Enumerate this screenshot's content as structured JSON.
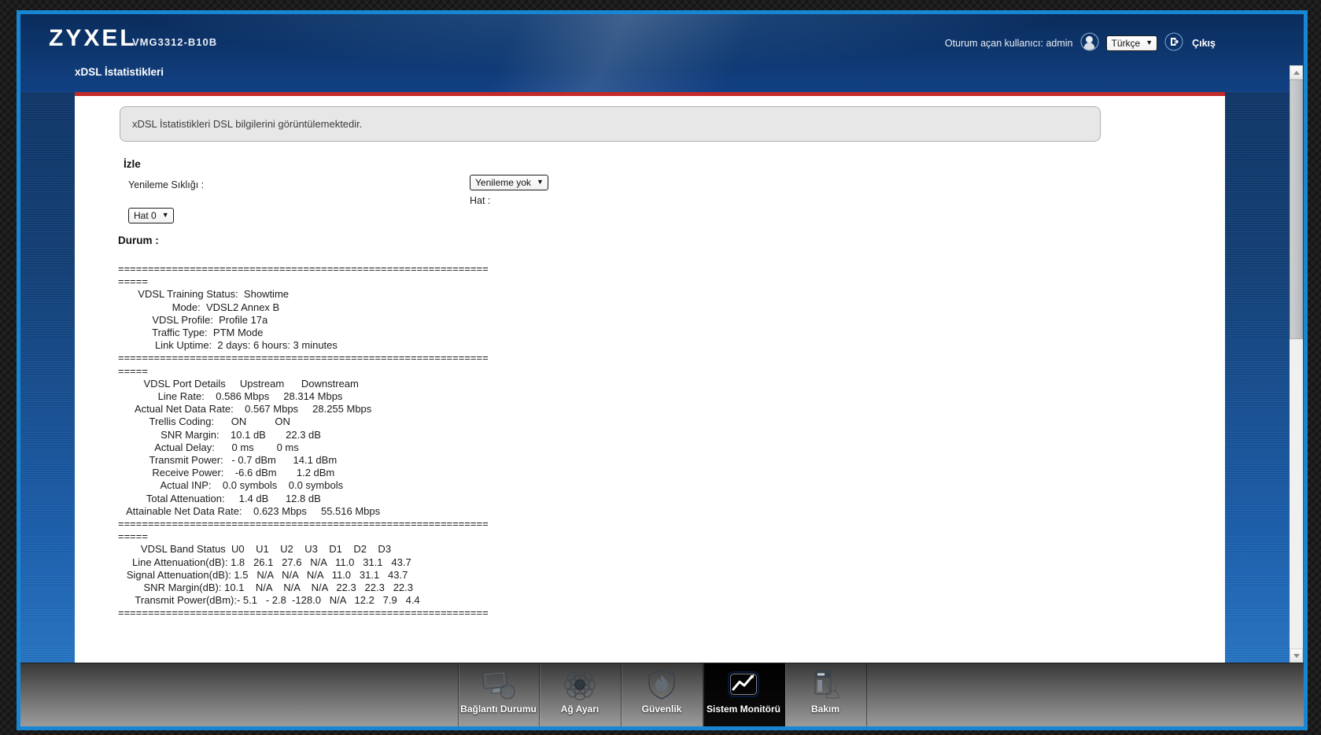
{
  "header": {
    "brand": "ZYXEL",
    "model": "VMG3312-B10B",
    "page_title": "xDSL İstatistikleri",
    "logged_in_label": "Oturum açan kullanıcı:  admin",
    "language_selected": "Türkçe",
    "logout_label": "Çıkış"
  },
  "info_box": {
    "text": "xDSL İstatistikleri DSL bilgilerini görüntülemektedir."
  },
  "monitor": {
    "section_title": "İzle",
    "refresh_label": "Yenileme Sıklığı :",
    "refresh_selected": "Yenileme yok",
    "line_label": "Hat :",
    "line_selected": "Hat 0",
    "status_label": "Durum :"
  },
  "status_lines": [
    "==============================================================",
    "=====",
    "       VDSL Training Status:  Showtime",
    "                   Mode:  VDSL2 Annex B",
    "            VDSL Profile:  Profile 17a",
    "            Traffic Type:  PTM Mode",
    "             Link Uptime:  2 days: 6 hours: 3 minutes",
    "==============================================================",
    "=====",
    "         VDSL Port Details     Upstream      Downstream",
    "              Line Rate:    0.586 Mbps     28.314 Mbps",
    "      Actual Net Data Rate:    0.567 Mbps     28.255 Mbps",
    "           Trellis Coding:      ON          ON",
    "               SNR Margin:    10.1 dB       22.3 dB",
    "             Actual Delay:      0 ms        0 ms",
    "           Transmit Power:   - 0.7 dBm      14.1 dBm",
    "            Receive Power:    -6.6 dBm       1.2 dBm",
    "               Actual INP:    0.0 symbols    0.0 symbols",
    "          Total Attenuation:     1.4 dB      12.8 dB",
    "   Attainable Net Data Rate:    0.623 Mbps     55.516 Mbps",
    "==============================================================",
    "=====",
    "        VDSL Band Status  U0    U1    U2    U3    D1    D2    D3",
    "     Line Attenuation(dB): 1.8   26.1   27.6   N/A   11.0   31.1   43.7",
    "   Signal Attenuation(dB): 1.5   N/A   N/A   N/A   11.0   31.1   43.7",
    "         SNR Margin(dB): 10.1    N/A    N/A    N/A   22.3   22.3   22.3",
    "      Transmit Power(dBm):- 5.1   - 2.8  -128.0   N/A   12.2   7.9   4.4",
    "=============================================================="
  ],
  "nav": {
    "items": [
      {
        "name": "connection-status",
        "label": "Bağlantı Durumu",
        "icon": "connection-status-icon",
        "active": false
      },
      {
        "name": "network-setting",
        "label": "Ağ Ayarı",
        "icon": "network-setting-icon",
        "active": false
      },
      {
        "name": "security",
        "label": "Güvenlik",
        "icon": "security-icon",
        "active": false
      },
      {
        "name": "system-monitor",
        "label": "Sistem Monitörü",
        "icon": "system-monitor-icon",
        "active": true
      },
      {
        "name": "maintenance",
        "label": "Bakım",
        "icon": "maintenance-icon",
        "active": false
      }
    ]
  },
  "colors": {
    "accent_red": "#C32A2A",
    "window_border_blue": "#1787D3",
    "nav_active_bg": "#000000",
    "chart_icon_blue": "#2B64C4"
  }
}
